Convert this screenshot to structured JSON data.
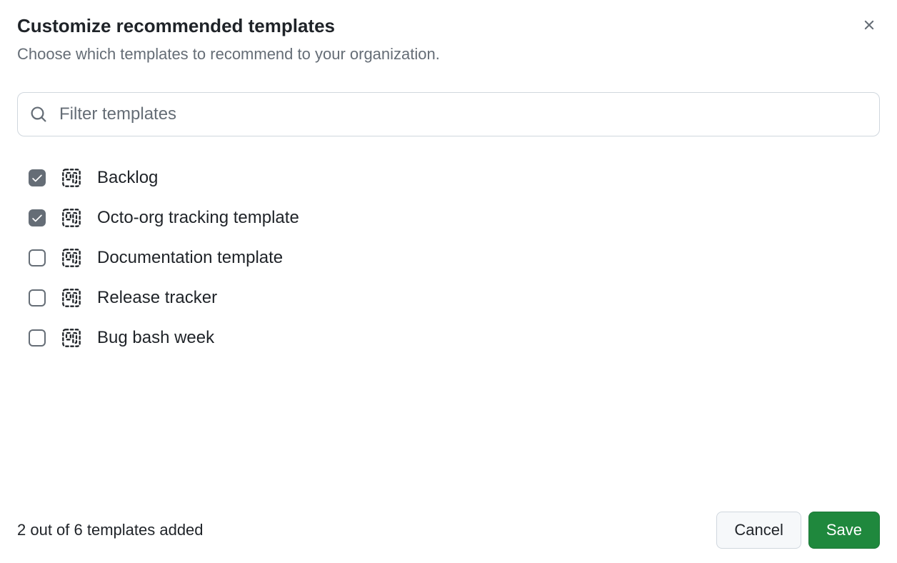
{
  "dialog": {
    "title": "Customize recommended templates",
    "subtitle": "Choose which templates to recommend to your organization."
  },
  "search": {
    "placeholder": "Filter templates",
    "value": ""
  },
  "templates": [
    {
      "label": "Backlog",
      "checked": true
    },
    {
      "label": "Octo-org tracking template",
      "checked": true
    },
    {
      "label": "Documentation template",
      "checked": false
    },
    {
      "label": "Release tracker",
      "checked": false
    },
    {
      "label": "Bug bash week",
      "checked": false
    }
  ],
  "footer": {
    "status": "2 out of 6 templates added",
    "cancel_label": "Cancel",
    "save_label": "Save"
  }
}
